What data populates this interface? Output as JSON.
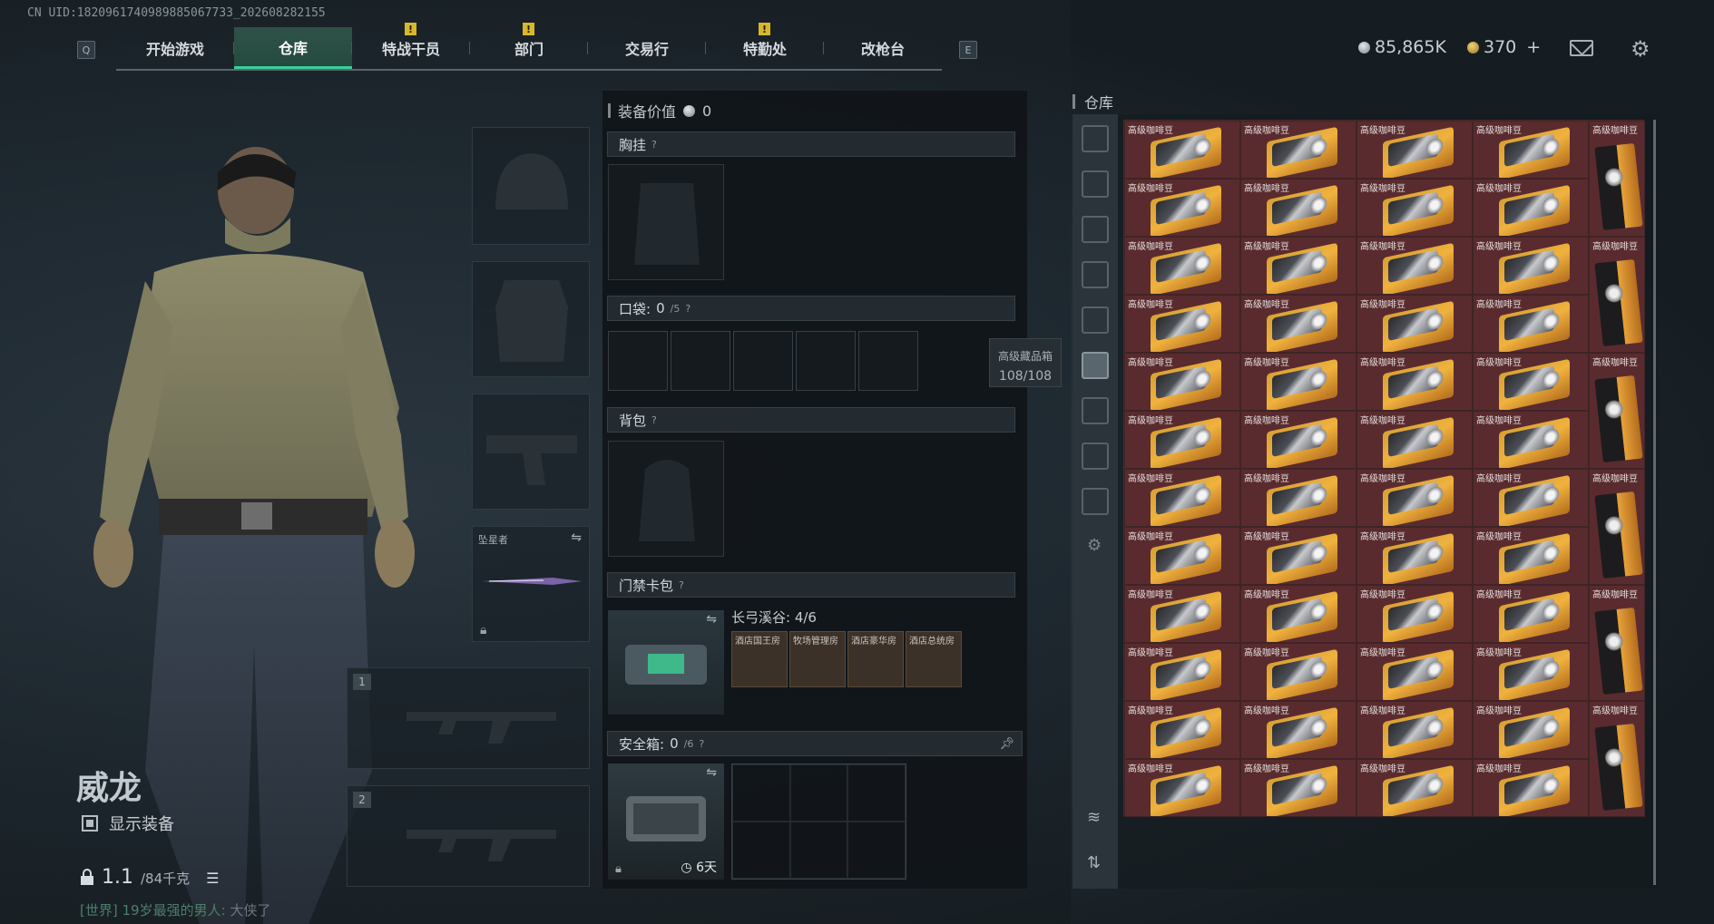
{
  "uid": "CN UID:1820961740989885067733_202608282155",
  "nav": {
    "left_key": "Q",
    "right_key": "E",
    "tabs": [
      {
        "label": "开始游戏",
        "active": false,
        "warn": false
      },
      {
        "label": "仓库",
        "active": true,
        "warn": false
      },
      {
        "label": "特战干员",
        "active": false,
        "warn": true
      },
      {
        "label": "部门",
        "active": false,
        "warn": true
      },
      {
        "label": "交易行",
        "active": false,
        "warn": false
      },
      {
        "label": "特勤处",
        "active": false,
        "warn": true
      },
      {
        "label": "改枪台",
        "active": false,
        "warn": false
      }
    ],
    "warn_mark": "!"
  },
  "currency": {
    "silver": "85,865K",
    "gold": "370",
    "add": "+"
  },
  "character": {
    "name": "威龙",
    "show_equipment": "显示装备",
    "weight": "1.1",
    "weight_max": "/84千克"
  },
  "chat": {
    "channel": "[世界]",
    "user": "19岁最强的男人:",
    "message": "大侠了"
  },
  "equipment": {
    "melee_label": "坠星者",
    "slot1": "1",
    "slot2": "2"
  },
  "loadout": {
    "value_label": "装备价值",
    "value": "0",
    "chest": "胸挂",
    "pocket": "口袋:",
    "pocket_count": "0",
    "pocket_max": "/5",
    "backpack": "背包",
    "keycard": "门禁卡包",
    "keycard_zone": "长弓溪谷: 4/6",
    "keycards": [
      "酒店国王房",
      "牧场管理房",
      "酒店豪华房",
      "酒店总统房"
    ],
    "safe": "安全箱:",
    "safe_count": "0",
    "safe_max": "/6",
    "safe_timer": "6天",
    "help": "?"
  },
  "tooltip": {
    "title": "高级藏品箱",
    "value": "108/108"
  },
  "storage": {
    "title": "仓库",
    "item_name": "高级咖啡豆"
  },
  "colors": {
    "accent": "#35d19a",
    "item_bg": "#5a2b2e",
    "warn": "#d9b72b"
  }
}
